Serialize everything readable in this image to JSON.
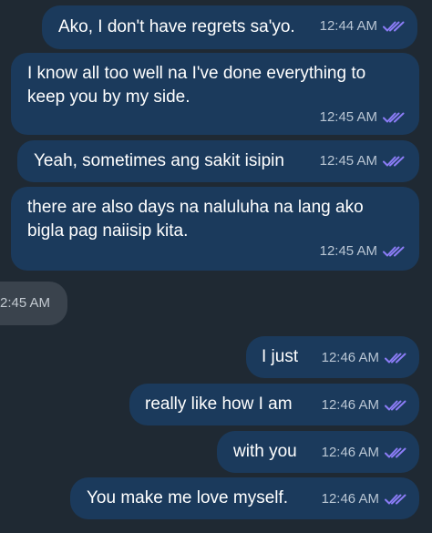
{
  "colors": {
    "background": "#1f2933",
    "outgoing_bubble": "#1b3a5c",
    "incoming_bubble": "#3a434d",
    "read_ticks": "#8b7cf6"
  },
  "messages": [
    {
      "text": "Ako, I don't have regrets sa'yo.",
      "time": "12:44 AM",
      "status_icon": "double-check-read-icon"
    },
    {
      "line1": "I know all too well na I've done everything to",
      "line2": "keep you by my side.",
      "time": "12:45 AM",
      "status_icon": "double-check-read-icon"
    },
    {
      "text": "Yeah, sometimes ang sakit isipin",
      "time": "12:45 AM",
      "status_icon": "double-check-read-icon"
    },
    {
      "line1": "there are also days na naluluha na lang ako",
      "line2": "bigla pag naiisip kita.",
      "time": "12:45 AM",
      "status_icon": "double-check-read-icon"
    },
    {
      "time": "2:45 AM"
    },
    {
      "text": "I just",
      "time": "12:46 AM",
      "status_icon": "double-check-read-icon"
    },
    {
      "text": "really like how I am",
      "time": "12:46 AM",
      "status_icon": "double-check-read-icon"
    },
    {
      "text": "with you",
      "time": "12:46 AM",
      "status_icon": "double-check-read-icon"
    },
    {
      "text": "You make me love myself.",
      "time": "12:46 AM",
      "status_icon": "double-check-read-icon"
    }
  ]
}
